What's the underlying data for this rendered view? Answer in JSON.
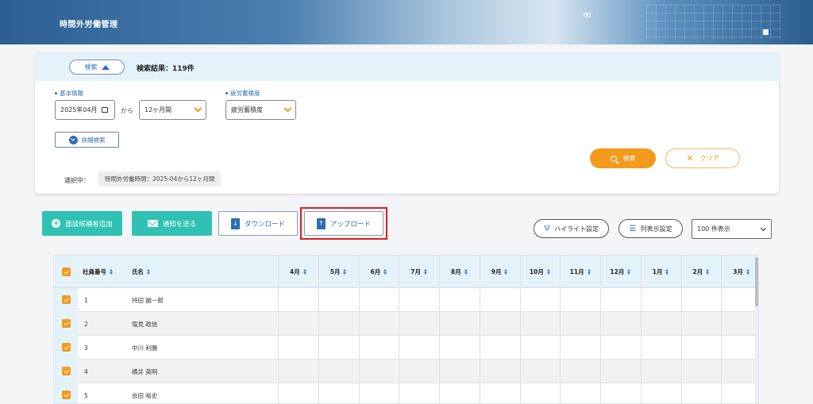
{
  "app": {
    "title": "時間外労働管理"
  },
  "search_panel": {
    "toggle_label": "検索",
    "result_label": "検索結果：",
    "result_count": "119件",
    "basic_info_label": "基本情報",
    "fatigue_label": "疲労蓄積度",
    "date_value": "2025年04月",
    "from_text": "から",
    "period_value": "12ヶ月間",
    "fatigue_value": "疲労蓄積度",
    "detail_search_label": "詳細検索",
    "selected_label": "選択中：",
    "selected_chip": "時間外労働時間：2025-04から12ヶ月間",
    "search_button": "検索",
    "clear_button": "クリア"
  },
  "actions": {
    "add_candidate": "面談候補者追加",
    "send_notice": "通知を送る",
    "download": "ダウンロード",
    "upload": "アップロード",
    "highlight_settings": "ハイライト設定",
    "column_settings": "列表示設定",
    "rows_per_page": "100 件表示"
  },
  "table": {
    "headers": {
      "employee_no": "社員番号",
      "name": "氏名",
      "months": [
        "4月",
        "5月",
        "6月",
        "7月",
        "8月",
        "9月",
        "10月",
        "11月",
        "12月",
        "1月",
        "2月",
        "3月"
      ]
    },
    "rows": [
      {
        "no": "1",
        "name": "持田 誠一郎"
      },
      {
        "no": "2",
        "name": "塩見 政信"
      },
      {
        "no": "3",
        "name": "中川 利勝"
      },
      {
        "no": "4",
        "name": "横井 英明"
      },
      {
        "no": "5",
        "name": "会田 裕史"
      }
    ]
  },
  "colors": {
    "accent": "#f29a1c",
    "teal": "#2fc1b3",
    "primary": "#2c6db0",
    "header_bg": "#e4f3fa",
    "highlight_border": "#e11b22"
  }
}
